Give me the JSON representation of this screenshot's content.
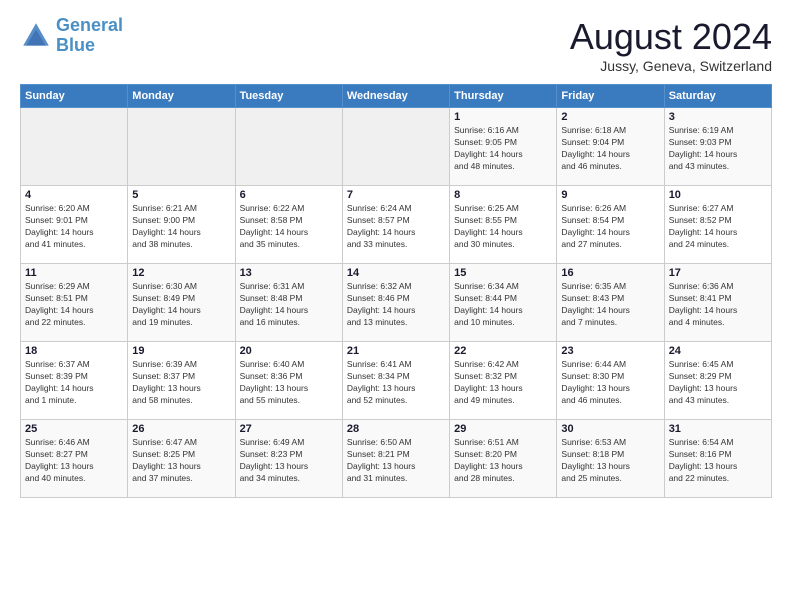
{
  "logo": {
    "line1": "General",
    "line2": "Blue"
  },
  "title": "August 2024",
  "location": "Jussy, Geneva, Switzerland",
  "days_header": [
    "Sunday",
    "Monday",
    "Tuesday",
    "Wednesday",
    "Thursday",
    "Friday",
    "Saturday"
  ],
  "weeks": [
    [
      {
        "day": "",
        "info": ""
      },
      {
        "day": "",
        "info": ""
      },
      {
        "day": "",
        "info": ""
      },
      {
        "day": "",
        "info": ""
      },
      {
        "day": "1",
        "info": "Sunrise: 6:16 AM\nSunset: 9:05 PM\nDaylight: 14 hours\nand 48 minutes."
      },
      {
        "day": "2",
        "info": "Sunrise: 6:18 AM\nSunset: 9:04 PM\nDaylight: 14 hours\nand 46 minutes."
      },
      {
        "day": "3",
        "info": "Sunrise: 6:19 AM\nSunset: 9:03 PM\nDaylight: 14 hours\nand 43 minutes."
      }
    ],
    [
      {
        "day": "4",
        "info": "Sunrise: 6:20 AM\nSunset: 9:01 PM\nDaylight: 14 hours\nand 41 minutes."
      },
      {
        "day": "5",
        "info": "Sunrise: 6:21 AM\nSunset: 9:00 PM\nDaylight: 14 hours\nand 38 minutes."
      },
      {
        "day": "6",
        "info": "Sunrise: 6:22 AM\nSunset: 8:58 PM\nDaylight: 14 hours\nand 35 minutes."
      },
      {
        "day": "7",
        "info": "Sunrise: 6:24 AM\nSunset: 8:57 PM\nDaylight: 14 hours\nand 33 minutes."
      },
      {
        "day": "8",
        "info": "Sunrise: 6:25 AM\nSunset: 8:55 PM\nDaylight: 14 hours\nand 30 minutes."
      },
      {
        "day": "9",
        "info": "Sunrise: 6:26 AM\nSunset: 8:54 PM\nDaylight: 14 hours\nand 27 minutes."
      },
      {
        "day": "10",
        "info": "Sunrise: 6:27 AM\nSunset: 8:52 PM\nDaylight: 14 hours\nand 24 minutes."
      }
    ],
    [
      {
        "day": "11",
        "info": "Sunrise: 6:29 AM\nSunset: 8:51 PM\nDaylight: 14 hours\nand 22 minutes."
      },
      {
        "day": "12",
        "info": "Sunrise: 6:30 AM\nSunset: 8:49 PM\nDaylight: 14 hours\nand 19 minutes."
      },
      {
        "day": "13",
        "info": "Sunrise: 6:31 AM\nSunset: 8:48 PM\nDaylight: 14 hours\nand 16 minutes."
      },
      {
        "day": "14",
        "info": "Sunrise: 6:32 AM\nSunset: 8:46 PM\nDaylight: 14 hours\nand 13 minutes."
      },
      {
        "day": "15",
        "info": "Sunrise: 6:34 AM\nSunset: 8:44 PM\nDaylight: 14 hours\nand 10 minutes."
      },
      {
        "day": "16",
        "info": "Sunrise: 6:35 AM\nSunset: 8:43 PM\nDaylight: 14 hours\nand 7 minutes."
      },
      {
        "day": "17",
        "info": "Sunrise: 6:36 AM\nSunset: 8:41 PM\nDaylight: 14 hours\nand 4 minutes."
      }
    ],
    [
      {
        "day": "18",
        "info": "Sunrise: 6:37 AM\nSunset: 8:39 PM\nDaylight: 14 hours\nand 1 minute."
      },
      {
        "day": "19",
        "info": "Sunrise: 6:39 AM\nSunset: 8:37 PM\nDaylight: 13 hours\nand 58 minutes."
      },
      {
        "day": "20",
        "info": "Sunrise: 6:40 AM\nSunset: 8:36 PM\nDaylight: 13 hours\nand 55 minutes."
      },
      {
        "day": "21",
        "info": "Sunrise: 6:41 AM\nSunset: 8:34 PM\nDaylight: 13 hours\nand 52 minutes."
      },
      {
        "day": "22",
        "info": "Sunrise: 6:42 AM\nSunset: 8:32 PM\nDaylight: 13 hours\nand 49 minutes."
      },
      {
        "day": "23",
        "info": "Sunrise: 6:44 AM\nSunset: 8:30 PM\nDaylight: 13 hours\nand 46 minutes."
      },
      {
        "day": "24",
        "info": "Sunrise: 6:45 AM\nSunset: 8:29 PM\nDaylight: 13 hours\nand 43 minutes."
      }
    ],
    [
      {
        "day": "25",
        "info": "Sunrise: 6:46 AM\nSunset: 8:27 PM\nDaylight: 13 hours\nand 40 minutes."
      },
      {
        "day": "26",
        "info": "Sunrise: 6:47 AM\nSunset: 8:25 PM\nDaylight: 13 hours\nand 37 minutes."
      },
      {
        "day": "27",
        "info": "Sunrise: 6:49 AM\nSunset: 8:23 PM\nDaylight: 13 hours\nand 34 minutes."
      },
      {
        "day": "28",
        "info": "Sunrise: 6:50 AM\nSunset: 8:21 PM\nDaylight: 13 hours\nand 31 minutes."
      },
      {
        "day": "29",
        "info": "Sunrise: 6:51 AM\nSunset: 8:20 PM\nDaylight: 13 hours\nand 28 minutes."
      },
      {
        "day": "30",
        "info": "Sunrise: 6:53 AM\nSunset: 8:18 PM\nDaylight: 13 hours\nand 25 minutes."
      },
      {
        "day": "31",
        "info": "Sunrise: 6:54 AM\nSunset: 8:16 PM\nDaylight: 13 hours\nand 22 minutes."
      }
    ]
  ]
}
